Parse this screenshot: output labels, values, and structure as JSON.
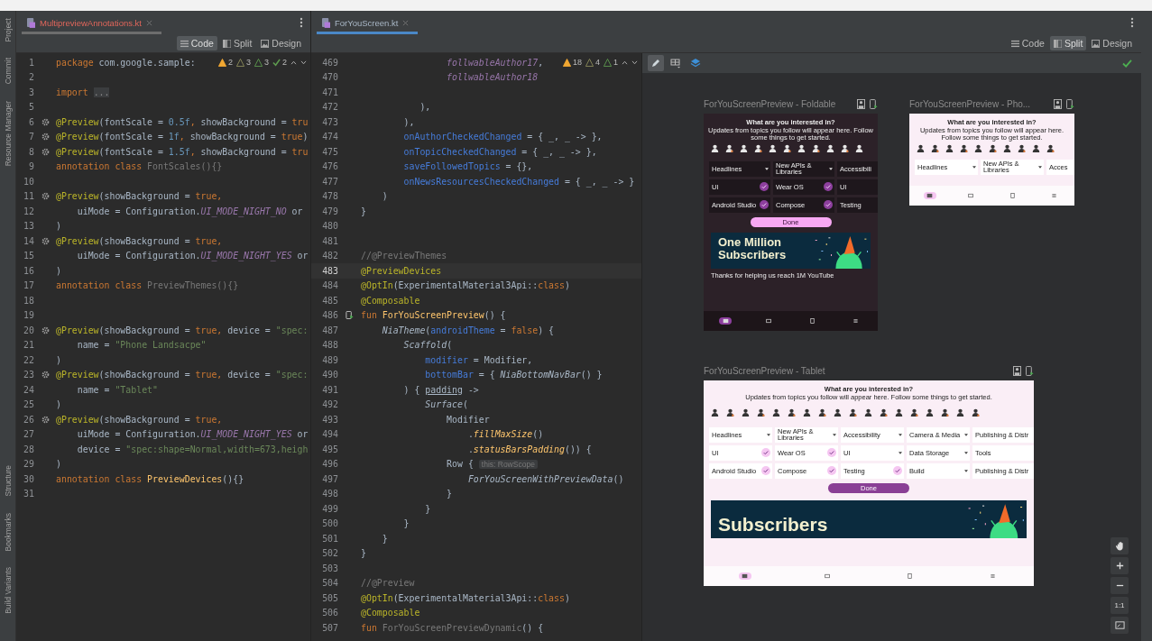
{
  "tool_windows": {
    "top": [
      "Project",
      "Commit",
      "Resource Manager"
    ],
    "bottom": [
      "Structure",
      "Bookmarks",
      "Build Variants"
    ]
  },
  "left_editor": {
    "tab": {
      "label": "MultipreviewAnnotations.kt",
      "selected": false,
      "error": true
    },
    "view_modes": [
      {
        "kind": "code",
        "label": "Code",
        "selected": true
      },
      {
        "kind": "split",
        "label": "Split",
        "selected": false
      },
      {
        "kind": "design",
        "label": "Design",
        "selected": false
      }
    ],
    "lines": [
      {
        "num": "1",
        "current": false,
        "tokens": [
          {
            "kind": "k",
            "text": "package"
          },
          {
            "kind": "t",
            "text": " com.google.sample:"
          }
        ],
        "inspections": [
          {
            "kind": "warning",
            "count": "2"
          },
          {
            "kind": "weak",
            "count": "3"
          },
          {
            "kind": "typo",
            "count": "3"
          },
          {
            "kind": "ok",
            "count": "2"
          }
        ]
      },
      {
        "num": "2",
        "current": false
      },
      {
        "num": "3",
        "current": false,
        "tokens": [
          {
            "kind": "k",
            "text": "import "
          },
          {
            "kind": "f",
            "text": "..."
          }
        ]
      },
      {
        "num": "5",
        "current": false
      },
      {
        "num": "6",
        "current": false,
        "gutter": {
          "kind": "gear"
        },
        "tokens": [
          {
            "kind": "a",
            "text": "@Preview"
          },
          {
            "kind": "t",
            "text": "(fontScale = "
          },
          {
            "kind": "n",
            "text": "0.5f"
          },
          {
            "kind": "k",
            "text": ", "
          },
          {
            "kind": "t",
            "text": "showBackground = "
          },
          {
            "kind": "k",
            "text": "tru"
          }
        ]
      },
      {
        "num": "7",
        "current": false,
        "gutter": {
          "kind": "gear"
        },
        "tokens": [
          {
            "kind": "a",
            "text": "@Preview"
          },
          {
            "kind": "t",
            "text": "(fontScale = "
          },
          {
            "kind": "n",
            "text": "1f"
          },
          {
            "kind": "k",
            "text": ", "
          },
          {
            "kind": "t",
            "text": "showBackground = "
          },
          {
            "kind": "k",
            "text": "true"
          },
          {
            "kind": "t",
            "text": ")"
          }
        ]
      },
      {
        "num": "8",
        "current": false,
        "gutter": {
          "kind": "gear"
        },
        "tokens": [
          {
            "kind": "a",
            "text": "@Preview"
          },
          {
            "kind": "t",
            "text": "(fontScale = "
          },
          {
            "kind": "n",
            "text": "1.5f"
          },
          {
            "kind": "k",
            "text": ", "
          },
          {
            "kind": "t",
            "text": "showBackground = "
          },
          {
            "kind": "k",
            "text": "tru"
          }
        ]
      },
      {
        "num": "9",
        "current": false,
        "tokens": [
          {
            "kind": "k",
            "text": "annotation class "
          },
          {
            "kind": "g",
            "text": "FontScales(){}"
          }
        ]
      },
      {
        "num": "10",
        "current": false
      },
      {
        "num": "11",
        "current": false,
        "gutter": {
          "kind": "gear"
        },
        "tokens": [
          {
            "kind": "a",
            "text": "@Preview"
          },
          {
            "kind": "t",
            "text": "(showBackground = "
          },
          {
            "kind": "k",
            "text": "true,"
          }
        ]
      },
      {
        "num": "12",
        "current": false,
        "tokens": [
          {
            "kind": "t",
            "text": "    uiMode = Configuration."
          },
          {
            "kind": "c",
            "text": "UI_MODE_NIGHT_NO"
          },
          {
            "kind": "t",
            "text": " or"
          }
        ]
      },
      {
        "num": "13",
        "current": false,
        "tokens": [
          {
            "kind": "t",
            "text": ")"
          }
        ]
      },
      {
        "num": "14",
        "current": false,
        "gutter": {
          "kind": "gear"
        },
        "tokens": [
          {
            "kind": "a",
            "text": "@Preview"
          },
          {
            "kind": "t",
            "text": "(showBackground = "
          },
          {
            "kind": "k",
            "text": "true,"
          }
        ]
      },
      {
        "num": "15",
        "current": false,
        "tokens": [
          {
            "kind": "t",
            "text": "    uiMode = Configuration."
          },
          {
            "kind": "c",
            "text": "UI_MODE_NIGHT_YES"
          },
          {
            "kind": "t",
            "text": " or"
          }
        ]
      },
      {
        "num": "16",
        "current": false,
        "tokens": [
          {
            "kind": "t",
            "text": ")"
          }
        ]
      },
      {
        "num": "17",
        "current": false,
        "tokens": [
          {
            "kind": "k",
            "text": "annotation class "
          },
          {
            "kind": "g",
            "text": "PreviewThemes(){}"
          }
        ]
      },
      {
        "num": "18",
        "current": false
      },
      {
        "num": "19",
        "current": false
      },
      {
        "num": "20",
        "current": false,
        "gutter": {
          "kind": "gear"
        },
        "tokens": [
          {
            "kind": "a",
            "text": "@Preview"
          },
          {
            "kind": "t",
            "text": "(showBackground = "
          },
          {
            "kind": "k",
            "text": "true, "
          },
          {
            "kind": "t",
            "text": "device = "
          },
          {
            "kind": "s",
            "text": "\"spec:"
          }
        ]
      },
      {
        "num": "21",
        "current": false,
        "tokens": [
          {
            "kind": "t",
            "text": "    name = "
          },
          {
            "kind": "s",
            "text": "\"Phone Landsacpe\""
          }
        ]
      },
      {
        "num": "22",
        "current": false,
        "tokens": [
          {
            "kind": "t",
            "text": ")"
          }
        ]
      },
      {
        "num": "23",
        "current": false,
        "gutter": {
          "kind": "gear"
        },
        "tokens": [
          {
            "kind": "a",
            "text": "@Preview"
          },
          {
            "kind": "t",
            "text": "(showBackground = "
          },
          {
            "kind": "k",
            "text": "true, "
          },
          {
            "kind": "t",
            "text": "device = "
          },
          {
            "kind": "s",
            "text": "\"spec:"
          }
        ]
      },
      {
        "num": "24",
        "current": false,
        "tokens": [
          {
            "kind": "t",
            "text": "    name = "
          },
          {
            "kind": "s",
            "text": "\"Tablet\""
          }
        ]
      },
      {
        "num": "25",
        "current": false,
        "tokens": [
          {
            "kind": "t",
            "text": ")"
          }
        ]
      },
      {
        "num": "26",
        "current": false,
        "gutter": {
          "kind": "gear"
        },
        "tokens": [
          {
            "kind": "a",
            "text": "@Preview"
          },
          {
            "kind": "t",
            "text": "(showBackground = "
          },
          {
            "kind": "k",
            "text": "true,"
          }
        ]
      },
      {
        "num": "27",
        "current": false,
        "tokens": [
          {
            "kind": "t",
            "text": "    uiMode = Configuration."
          },
          {
            "kind": "c",
            "text": "UI_MODE_NIGHT_YES"
          },
          {
            "kind": "t",
            "text": " or"
          }
        ]
      },
      {
        "num": "28",
        "current": false,
        "tokens": [
          {
            "kind": "t",
            "text": "    device = "
          },
          {
            "kind": "s",
            "text": "\"spec:shape=Normal,width=673,heigh"
          }
        ]
      },
      {
        "num": "29",
        "current": false,
        "tokens": [
          {
            "kind": "t",
            "text": ")"
          }
        ]
      },
      {
        "num": "30",
        "current": false,
        "tokens": [
          {
            "kind": "k",
            "text": "annotation class "
          },
          {
            "kind": "y",
            "text": "PreviewDevices"
          },
          {
            "kind": "t",
            "text": "(){}"
          }
        ]
      },
      {
        "num": "31",
        "current": false
      }
    ]
  },
  "right_editor": {
    "tab": {
      "label": "ForYouScreen.kt",
      "selected": true,
      "error": false
    },
    "view_modes": [
      {
        "kind": "code",
        "label": "Code",
        "selected": false
      },
      {
        "kind": "split",
        "label": "Split",
        "selected": true
      },
      {
        "kind": "design",
        "label": "Design",
        "selected": false
      }
    ],
    "lines": [
      {
        "num": "469",
        "current": false,
        "tokens": [
          {
            "kind": "c",
            "text": "                follwableAuthor17"
          },
          {
            "kind": "t",
            "text": ","
          }
        ],
        "inspections": [
          {
            "kind": "warning",
            "count": "18"
          },
          {
            "kind": "weak",
            "count": "4"
          },
          {
            "kind": "typo",
            "count": "1"
          }
        ]
      },
      {
        "num": "470",
        "current": false,
        "tokens": [
          {
            "kind": "c",
            "text": "                follwableAuthor18"
          }
        ]
      },
      {
        "num": "471",
        "current": false
      },
      {
        "num": "472",
        "current": false,
        "tokens": [
          {
            "kind": "t",
            "text": "           ),"
          }
        ]
      },
      {
        "num": "473",
        "current": false,
        "tokens": [
          {
            "kind": "t",
            "text": "        ),"
          }
        ]
      },
      {
        "num": "474",
        "current": false,
        "tokens": [
          {
            "kind": "p",
            "text": "        onAuthorCheckedChanged"
          },
          {
            "kind": "t",
            "text": " = { _, _ -> },"
          }
        ]
      },
      {
        "num": "475",
        "current": false,
        "tokens": [
          {
            "kind": "p",
            "text": "        onTopicCheckedChanged"
          },
          {
            "kind": "t",
            "text": " = { _, _ -> },"
          }
        ]
      },
      {
        "num": "476",
        "current": false,
        "tokens": [
          {
            "kind": "p",
            "text": "        saveFollowedTopics"
          },
          {
            "kind": "t",
            "text": " = {},"
          }
        ]
      },
      {
        "num": "477",
        "current": false,
        "tokens": [
          {
            "kind": "p",
            "text": "        onNewsResourcesCheckedChanged"
          },
          {
            "kind": "t",
            "text": " = { _, _ -> }"
          }
        ]
      },
      {
        "num": "478",
        "current": false,
        "tokens": [
          {
            "kind": "t",
            "text": "    )"
          }
        ]
      },
      {
        "num": "479",
        "current": false,
        "tokens": [
          {
            "kind": "t",
            "text": "}"
          }
        ]
      },
      {
        "num": "480",
        "current": false
      },
      {
        "num": "481",
        "current": false
      },
      {
        "num": "482",
        "current": false,
        "tokens": [
          {
            "kind": "g",
            "text": "//@PreviewThemes"
          }
        ]
      },
      {
        "num": "483",
        "current": true,
        "tokens": [
          {
            "kind": "a",
            "text": "@PreviewDevices"
          }
        ]
      },
      {
        "num": "484",
        "current": false,
        "tokens": [
          {
            "kind": "a",
            "text": "@OptIn"
          },
          {
            "kind": "t",
            "text": "(ExperimentalMaterial3Api::"
          },
          {
            "kind": "k",
            "text": "class"
          },
          {
            "kind": "t",
            "text": ")"
          }
        ]
      },
      {
        "num": "485",
        "current": false,
        "tokens": [
          {
            "kind": "a",
            "text": "@Composable"
          }
        ]
      },
      {
        "num": "486",
        "current": false,
        "gutter": {
          "kind": "preview"
        },
        "tokens": [
          {
            "kind": "k",
            "text": "fun "
          },
          {
            "kind": "y",
            "text": "ForYouScreenPreview"
          },
          {
            "kind": "t",
            "text": "() {"
          }
        ]
      },
      {
        "num": "487",
        "current": false,
        "tokens": [
          {
            "kind": "i",
            "text": "    NiaTheme"
          },
          {
            "kind": "t",
            "text": "("
          },
          {
            "kind": "p",
            "text": "androidTheme"
          },
          {
            "kind": "t",
            "text": " = "
          },
          {
            "kind": "k",
            "text": "false"
          },
          {
            "kind": "t",
            "text": ") {"
          }
        ]
      },
      {
        "num": "488",
        "current": false,
        "tokens": [
          {
            "kind": "i",
            "text": "        Scaffold"
          },
          {
            "kind": "t",
            "text": "("
          }
        ]
      },
      {
        "num": "489",
        "current": false,
        "tokens": [
          {
            "kind": "p",
            "text": "            modifier"
          },
          {
            "kind": "t",
            "text": " = Modifier,"
          }
        ]
      },
      {
        "num": "490",
        "current": false,
        "tokens": [
          {
            "kind": "p",
            "text": "            bottomBar"
          },
          {
            "kind": "t",
            "text": " = { "
          },
          {
            "kind": "i",
            "text": "NiaBottomNavBar"
          },
          {
            "kind": "t",
            "text": "() }"
          }
        ]
      },
      {
        "num": "491",
        "current": false,
        "tokens": [
          {
            "kind": "t",
            "text": "        ) { "
          },
          {
            "kind": "u",
            "text": "padding"
          },
          {
            "kind": "t",
            "text": " ->"
          }
        ]
      },
      {
        "num": "492",
        "current": false,
        "tokens": [
          {
            "kind": "i",
            "text": "            Surface"
          },
          {
            "kind": "t",
            "text": "("
          }
        ]
      },
      {
        "num": "493",
        "current": false,
        "tokens": [
          {
            "kind": "t",
            "text": "                Modifier"
          }
        ]
      },
      {
        "num": "494",
        "current": false,
        "tokens": [
          {
            "kind": "t",
            "text": "                    ."
          },
          {
            "kind": "e",
            "text": "fillMaxSize"
          },
          {
            "kind": "t",
            "text": "()"
          }
        ]
      },
      {
        "num": "495",
        "current": false,
        "tokens": [
          {
            "kind": "t",
            "text": "                    ."
          },
          {
            "kind": "e",
            "text": "statusBarsPadding"
          },
          {
            "kind": "t",
            "text": "()) {"
          }
        ]
      },
      {
        "num": "496",
        "current": false,
        "tokens": [
          {
            "kind": "t",
            "text": "                Row { "
          },
          {
            "kind": "h",
            "text": "this: RowScope"
          }
        ]
      },
      {
        "num": "497",
        "current": false,
        "tokens": [
          {
            "kind": "i",
            "text": "                    ForYouScreenWithPreviewData"
          },
          {
            "kind": "t",
            "text": "()"
          }
        ]
      },
      {
        "num": "498",
        "current": false,
        "tokens": [
          {
            "kind": "t",
            "text": "                }"
          }
        ]
      },
      {
        "num": "499",
        "current": false,
        "tokens": [
          {
            "kind": "t",
            "text": "            }"
          }
        ]
      },
      {
        "num": "500",
        "current": false,
        "tokens": [
          {
            "kind": "t",
            "text": "        }"
          }
        ]
      },
      {
        "num": "501",
        "current": false,
        "tokens": [
          {
            "kind": "t",
            "text": "    }"
          }
        ]
      },
      {
        "num": "502",
        "current": false,
        "tokens": [
          {
            "kind": "t",
            "text": "}"
          }
        ]
      },
      {
        "num": "503",
        "current": false
      },
      {
        "num": "504",
        "current": false,
        "tokens": [
          {
            "kind": "g",
            "text": "//@Preview"
          }
        ]
      },
      {
        "num": "505",
        "current": false,
        "tokens": [
          {
            "kind": "a",
            "text": "@OptIn"
          },
          {
            "kind": "t",
            "text": "(ExperimentalMaterial3Api::"
          },
          {
            "kind": "k",
            "text": "class"
          },
          {
            "kind": "t",
            "text": ")"
          }
        ]
      },
      {
        "num": "506",
        "current": false,
        "tokens": [
          {
            "kind": "a",
            "text": "@Composable"
          }
        ]
      },
      {
        "num": "507",
        "current": false,
        "tokens": [
          {
            "kind": "k",
            "text": "fun "
          },
          {
            "kind": "g",
            "text": "ForYouScreenPreviewDynamic"
          },
          {
            "kind": "t",
            "text": "() {"
          }
        ]
      }
    ]
  },
  "design": {
    "tools": [
      {
        "kind": "pencil",
        "selected": true
      },
      {
        "kind": "grid",
        "selected": false
      },
      {
        "kind": "layers",
        "selected": false
      }
    ],
    "status": {
      "kind": "ok"
    },
    "previews": [
      {
        "kind": "foldable",
        "title": "ForYouScreenPreview - Foldable",
        "dark": true,
        "heading": "What are you interested in?",
        "subtitle": "Updates from topics you follow will appear here. Follow some things to get started.",
        "topics": [
          {
            "label": "Headlines",
            "expandable": true,
            "followed": false
          },
          {
            "label": "New APIs & Libraries",
            "expandable": true,
            "followed": false
          },
          {
            "label": "Accessibili",
            "expandable": false,
            "followed": false
          },
          {
            "label": "UI",
            "expandable": false,
            "followed": true
          },
          {
            "label": "Wear OS",
            "expandable": false,
            "followed": true
          },
          {
            "label": "UI",
            "expandable": false,
            "followed": false
          },
          {
            "label": "Android Studio",
            "expandable": false,
            "followed": true
          },
          {
            "label": "Compose",
            "expandable": false,
            "followed": true
          },
          {
            "label": "Testing",
            "expandable": false,
            "followed": false
          }
        ],
        "done": "Done",
        "banner": "One Million Subscribers",
        "news_title": "Thanks for helping us reach 1M YouTube",
        "nav": [
          {
            "selected": true
          },
          {
            "selected": false
          },
          {
            "selected": false
          },
          {
            "selected": false
          }
        ]
      },
      {
        "kind": "phone",
        "title": "ForYouScreenPreview - Pho...",
        "dark": false,
        "heading": "What are you interested in?",
        "subtitle": "Updates from topics you follow will appear here. Follow some things to get started.",
        "topics": [
          {
            "label": "Headlines",
            "expandable": true,
            "followed": false
          },
          {
            "label": "New APIs & Libraries",
            "expandable": true,
            "followed": false
          },
          {
            "label": "Acces",
            "expandable": false,
            "followed": false
          }
        ],
        "nav": [
          {
            "selected": true
          },
          {
            "selected": false
          },
          {
            "selected": false
          },
          {
            "selected": false
          }
        ]
      },
      {
        "kind": "tablet",
        "title": "ForYouScreenPreview - Tablet",
        "dark": false,
        "heading": "What are you interested in?",
        "subtitle": "Updates from topics you follow will appear here. Follow some things to get started.",
        "topics": [
          {
            "label": "Headlines",
            "expandable": true,
            "followed": false
          },
          {
            "label": "New APIs & Libraries",
            "expandable": true,
            "followed": false
          },
          {
            "label": "Accessibility",
            "expandable": true,
            "followed": false
          },
          {
            "label": "Camera & Media",
            "expandable": true,
            "followed": false
          },
          {
            "label": "Publishing & Distr",
            "expandable": false,
            "followed": false
          },
          {
            "label": "UI",
            "expandable": false,
            "followed": true
          },
          {
            "label": "Wear OS",
            "expandable": false,
            "followed": true
          },
          {
            "label": "UI",
            "expandable": true,
            "followed": false
          },
          {
            "label": "Data Storage",
            "expandable": true,
            "followed": false
          },
          {
            "label": "Tools",
            "expandable": false,
            "followed": false
          },
          {
            "label": "Android Studio",
            "expandable": false,
            "followed": true
          },
          {
            "label": "Compose",
            "expandable": false,
            "followed": true
          },
          {
            "label": "Testing",
            "expandable": false,
            "followed": true
          },
          {
            "label": "Build",
            "expandable": true,
            "followed": false
          },
          {
            "label": "Publishing & Distr",
            "expandable": false,
            "followed": false
          }
        ],
        "done": "Done",
        "banner": "Subscribers",
        "nav": [
          {
            "selected": true
          },
          {
            "selected": false
          },
          {
            "selected": false
          },
          {
            "selected": false
          }
        ]
      }
    ],
    "zoom_controls": [
      {
        "kind": "pan"
      },
      {
        "kind": "zoom_in"
      },
      {
        "kind": "zoom_out"
      },
      {
        "kind": "actual",
        "label": "1:1"
      },
      {
        "kind": "fit"
      }
    ]
  }
}
